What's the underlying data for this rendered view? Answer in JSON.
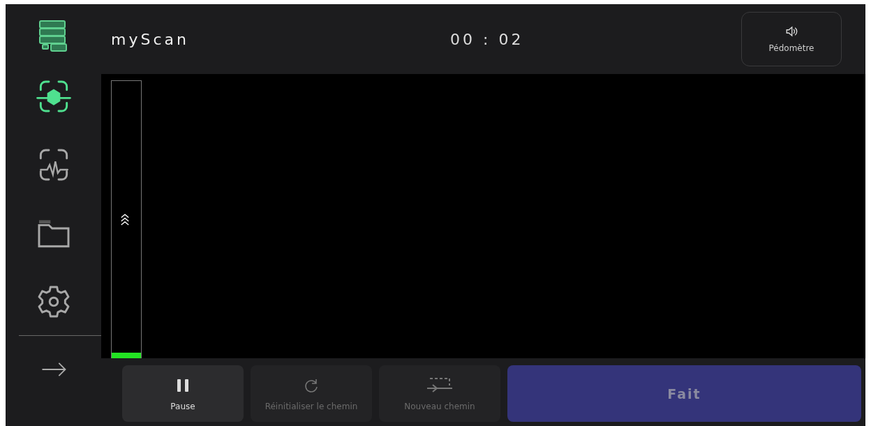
{
  "app": {
    "title": "myScan"
  },
  "timer": "00 : 02",
  "pedometer_button": {
    "label": "Pédomètre"
  },
  "sidebar": {
    "items": [
      {
        "kind": "scan",
        "selected": true
      },
      {
        "kind": "signal",
        "selected": false
      },
      {
        "kind": "folder",
        "selected": false
      },
      {
        "kind": "settings",
        "selected": false
      }
    ]
  },
  "progress": {
    "level": 0.02
  },
  "actions": [
    {
      "kind": "pause",
      "label": "Pause",
      "disabled": false
    },
    {
      "kind": "reset",
      "label": "Réinitialiser le chemin",
      "disabled": true
    },
    {
      "kind": "new-path",
      "label": "Nouveau chemin",
      "disabled": true
    }
  ],
  "done_button": {
    "label": "Fait"
  }
}
